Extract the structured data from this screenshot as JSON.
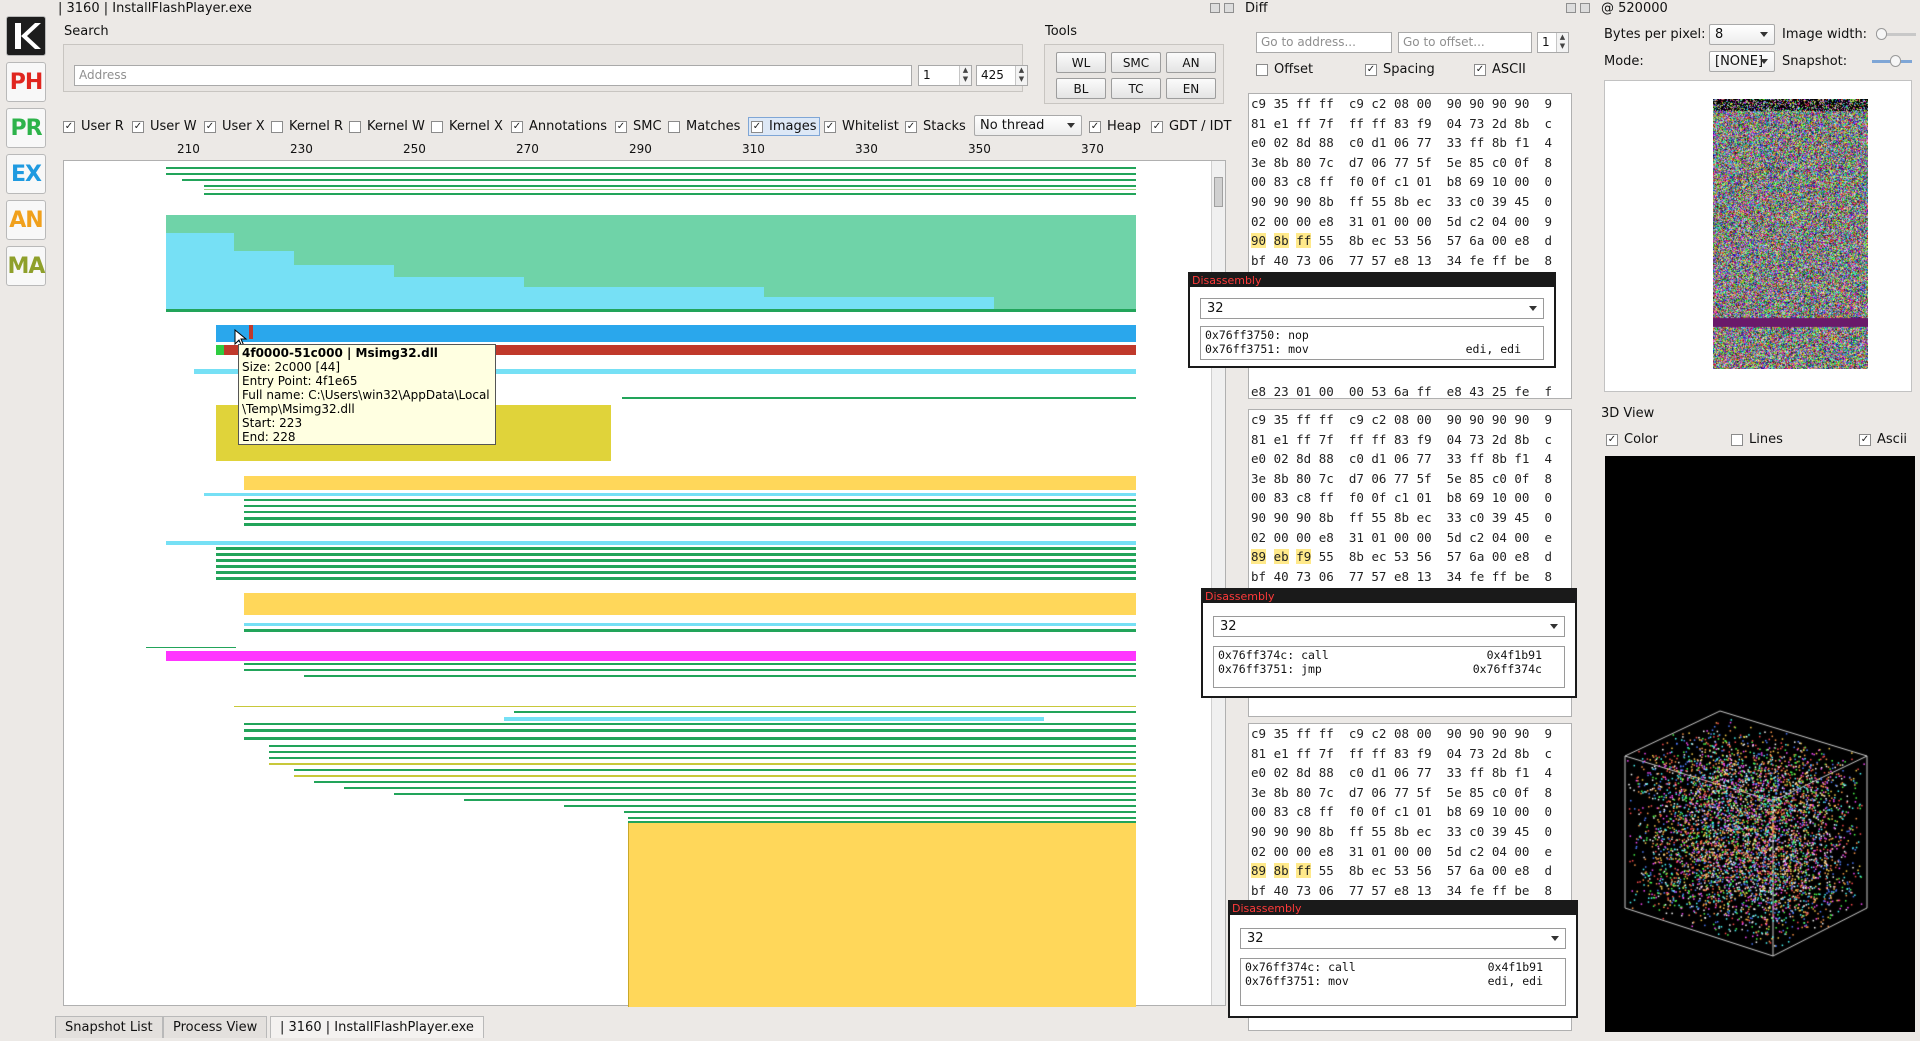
{
  "sidebar": {
    "buttons": [
      {
        "label": "K",
        "name": "k"
      },
      {
        "label": "PH",
        "name": "ph",
        "color": "#e0261f"
      },
      {
        "label": "PR",
        "name": "pr",
        "color": "#2db34a"
      },
      {
        "label": "EX",
        "name": "ex",
        "color": "#1f9ae0"
      },
      {
        "label": "AN",
        "name": "an",
        "color": "#f0a01c"
      },
      {
        "label": "MA",
        "name": "ma",
        "color": "#8fa02b"
      }
    ]
  },
  "main_window": {
    "title": "| 3160 | InstallFlashPlayer.exe",
    "search": {
      "label": "Search",
      "address_placeholder": "Address",
      "spin1": "1",
      "spin2": "425"
    },
    "tools": {
      "label": "Tools",
      "buttons": [
        "WL",
        "SMC",
        "AN",
        "BL",
        "TC",
        "EN"
      ]
    },
    "filters": [
      {
        "label": "User R",
        "checked": true
      },
      {
        "label": "User W",
        "checked": true
      },
      {
        "label": "User X",
        "checked": true
      },
      {
        "label": "Kernel R",
        "checked": false
      },
      {
        "label": "Kernel W",
        "checked": false
      },
      {
        "label": "Kernel X",
        "checked": false
      },
      {
        "label": "Annotations",
        "checked": true
      },
      {
        "label": "SMC",
        "checked": true
      },
      {
        "label": "Matches",
        "checked": false
      },
      {
        "label": "Images",
        "checked": true
      },
      {
        "label": "Whitelist",
        "checked": true
      },
      {
        "label": "Stacks",
        "checked": true
      }
    ],
    "thread_select": "No thread",
    "filters2": [
      {
        "label": "Heap",
        "checked": true
      },
      {
        "label": "GDT / IDT",
        "checked": true
      }
    ],
    "ruler_ticks": [
      "210",
      "230",
      "250",
      "270",
      "290",
      "310",
      "330",
      "350",
      "370"
    ],
    "tooltip": {
      "title": "4f0000-51c000 | Msimg32.dll",
      "size": "Size: 2c000 [44]",
      "entry": "Entry Point: 4f1e65",
      "fullname1": "Full name: C:\\Users\\win32\\AppData\\Local",
      "fullname2": "\\Temp\\Msimg32.dll",
      "start": "Start: 223",
      "end": "End: 228"
    }
  },
  "tabs": [
    "Snapshot List",
    "Process View",
    "| 3160 | InstallFlashPlayer.exe"
  ],
  "diff": {
    "title": "Diff",
    "address_placeholder": "Go to address...",
    "offset_placeholder": "Go to offset...",
    "spin": "1",
    "options": [
      {
        "label": "Offset",
        "checked": false
      },
      {
        "label": "Spacing",
        "checked": true
      },
      {
        "label": "ASCII",
        "checked": true
      }
    ],
    "pane1": [
      "c9 35 ff ff  c9 c2 08 00  90 90 90 90  9",
      "81 e1 ff 7f  ff ff 83 f9  04 73 2d 8b  c",
      "e0 02 8d 88  c0 d1 06 77  33 ff 8b f1  4",
      "3e 8b 80 7c  d7 06 77 5f  5e 85 c0 0f  8",
      "00 83 c8 ff  f0 0f c1 01  b8 69 10 00  0",
      "90 90 90 8b  ff 55 8b ec  33 c0 39 45  0",
      "02 00 00 e8  31 01 00 00  5d c2 04 00  9",
      "90 8b ff 55  8b ec 53 56  57 6a 00 e8  d",
      "bf 40 73 06  77 57 e8 13  34 fe ff be  8"
    ],
    "pane1_tail": "e8 23 01 00  00 53 6a ff  e8 43 25 fe  f",
    "pane2": [
      "c9 35 ff ff  c9 c2 08 00  90 90 90 90  9",
      "81 e1 ff 7f  ff ff 83 f9  04 73 2d 8b  c",
      "e0 02 8d 88  c0 d1 06 77  33 ff 8b f1  4",
      "3e 8b 80 7c  d7 06 77 5f  5e 85 c0 0f  8",
      "00 83 c8 ff  f0 0f c1 01  b8 69 10 00  0",
      "90 90 90 8b  ff 55 8b ec  33 c0 39 45  0",
      "02 00 00 e8  31 01 00 00  5d c2 04 00  e",
      "89 eb f9 55  8b ec 53 56  57 6a 00 e8  d",
      "bf 40 73 06  77 57 e8 13  34 fe ff be  8"
    ],
    "pane3": [
      "c9 35 ff ff  c9 c2 08 00  90 90 90 90  9",
      "81 e1 ff 7f  ff ff 83 f9  04 73 2d 8b  c",
      "e0 02 8d 88  c0 d1 06 77  33 ff 8b f1  4",
      "3e 8b 80 7c  d7 06 77 5f  5e 85 c0 0f  8",
      "00 83 c8 ff  f0 0f c1 01  b8 69 10 00  0",
      "90 90 90 8b  ff 55 8b ec  33 c0 39 45  0",
      "02 00 00 e8  31 01 00 00  5d c2 04 00  e",
      "89 8b ff 55  8b ec 53 56  57 6a 00 e8  d",
      "bf 40 73 06  77 57 e8 13  34 fe ff be  8"
    ],
    "highlight_color": "#ffe98a"
  },
  "disassembly": [
    {
      "header": "Disassembly",
      "mode": "32",
      "lines": [
        [
          "0x76ff3750: nop",
          ""
        ],
        [
          "0x76ff3751: mov",
          "edi, edi"
        ]
      ]
    },
    {
      "header": "Disassembly",
      "mode": "32",
      "lines": [
        [
          "0x76ff374c: call",
          "0x4f1b91"
        ],
        [
          "0x76ff3751: jmp",
          "0x76ff374c"
        ]
      ]
    },
    {
      "header": "Disassembly",
      "mode": "32",
      "lines": [
        [
          "0x76ff374c: call",
          "0x4f1b91"
        ],
        [
          "0x76ff3751: mov",
          "edi, edi"
        ]
      ]
    }
  ],
  "right_panel": {
    "title": "@ 520000",
    "bytes_per_pixel_label": "Bytes per pixel:",
    "bytes_per_pixel": "8",
    "image_width_label": "Image width:",
    "mode_label": "Mode:",
    "mode": "[NONE]",
    "snapshot_label": "Snapshot:",
    "view3d_title": "3D View",
    "view3d_options": [
      {
        "label": "Color",
        "checked": true
      },
      {
        "label": "Lines",
        "checked": false
      },
      {
        "label": "Ascii",
        "checked": true
      }
    ]
  }
}
